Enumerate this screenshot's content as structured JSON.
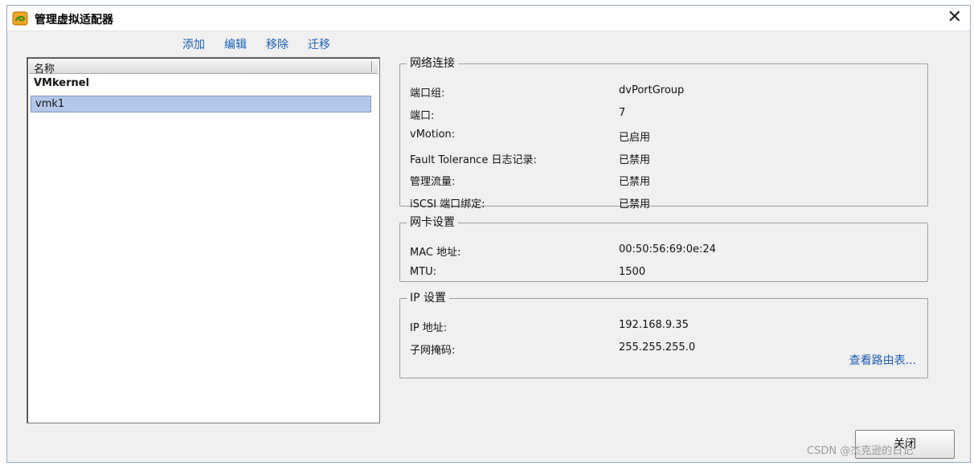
{
  "window": {
    "title": "管理虚拟适配器",
    "close_glyph": "✕"
  },
  "toolbar": {
    "add": "添加",
    "edit": "编辑",
    "remove": "移除",
    "migrate": "迁移"
  },
  "adapter_list": {
    "column_header": "名称",
    "group": "VMkernel",
    "selected_item": "vmk1"
  },
  "network_connection": {
    "legend": "网络连接",
    "rows": [
      {
        "label": "端口组:",
        "value": "dvPortGroup"
      },
      {
        "label": "端口:",
        "value": "7"
      },
      {
        "label": "vMotion:",
        "value": "已启用"
      },
      {
        "label": "Fault Tolerance 日志记录:",
        "value": "已禁用"
      },
      {
        "label": "管理流量:",
        "value": "已禁用"
      },
      {
        "label": "iSCSI 端口绑定:",
        "value": "已禁用"
      }
    ]
  },
  "nic_settings": {
    "legend": "网卡设置",
    "rows": [
      {
        "label": "MAC 地址:",
        "value": "00:50:56:69:0e:24"
      },
      {
        "label": "MTU:",
        "value": "1500"
      }
    ]
  },
  "ip_settings": {
    "legend": "IP 设置",
    "rows": [
      {
        "label": "IP 地址:",
        "value": "192.168.9.35"
      },
      {
        "label": "子网掩码:",
        "value": "255.255.255.0"
      }
    ],
    "view_routing_link": "查看路由表..."
  },
  "footer": {
    "close_button": "关闭",
    "watermark": "CSDN @杰克逊的日记"
  },
  "colors": {
    "link": "#1a5fb4",
    "selection": "#b3c8e6",
    "dialog_bg": "#f0f0f0"
  }
}
